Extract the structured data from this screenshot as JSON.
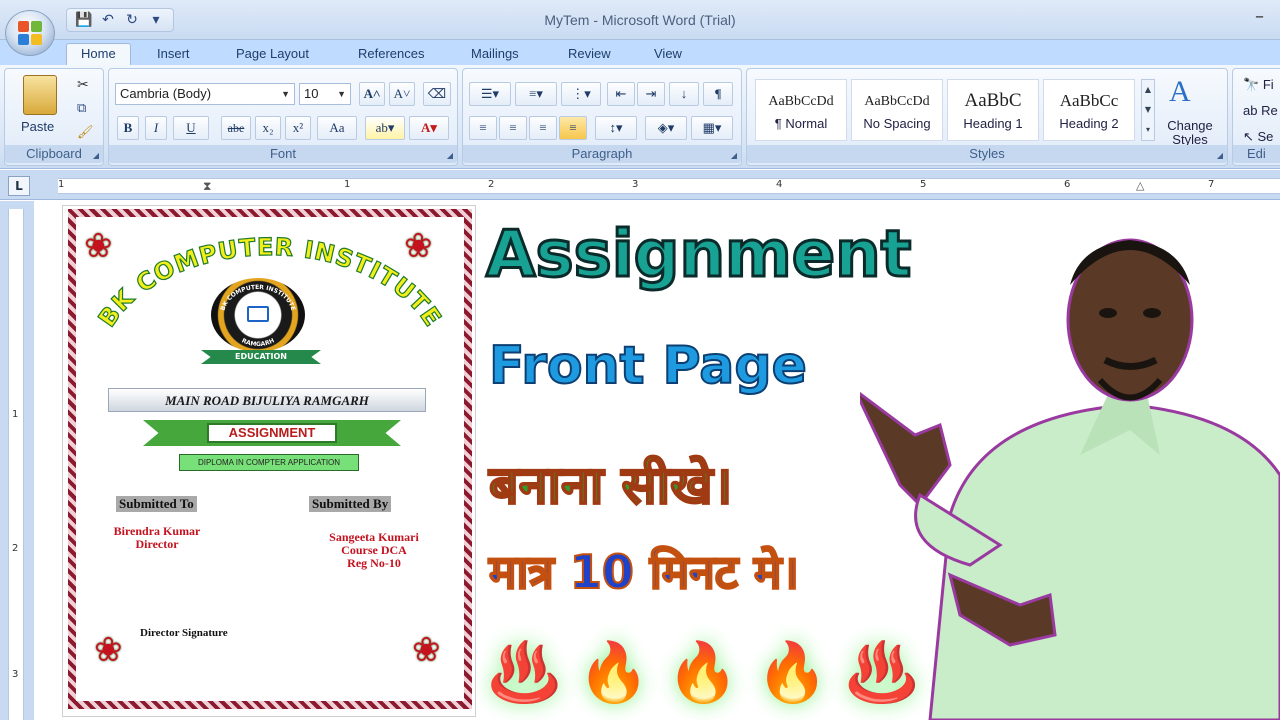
{
  "window": {
    "title": "MyTem - Microsoft Word (Trial)",
    "minimize": "–"
  },
  "qat": {
    "save": "💾",
    "undo": "↶",
    "redo": "↻",
    "more": "▾"
  },
  "tabs": [
    "Home",
    "Insert",
    "Page Layout",
    "References",
    "Mailings",
    "Review",
    "View"
  ],
  "ribbon": {
    "clipboard": {
      "label": "Clipboard",
      "paste": "Paste"
    },
    "font": {
      "label": "Font",
      "family": "Cambria (Body)",
      "size": "10",
      "bold": "B",
      "italic": "I",
      "underline": "U",
      "strike": "abe",
      "sub": "x₂",
      "sup": "x²",
      "case": "Aa"
    },
    "paragraph": {
      "label": "Paragraph"
    },
    "styles": {
      "label": "Styles",
      "tiles": [
        {
          "sample": "AaBbCcDd",
          "name": "¶ Normal"
        },
        {
          "sample": "AaBbCcDd",
          "name": "No Spacing"
        },
        {
          "sample": "AaBbC",
          "name": "Heading 1"
        },
        {
          "sample": "AaBbCc",
          "name": "Heading 2"
        }
      ],
      "change_styles": "Change Styles"
    },
    "editing": {
      "label": "Edi",
      "find": "Fi",
      "replace": "Re",
      "select": "Se"
    }
  },
  "ruler": {
    "corner": "L",
    "numbers": [
      "1",
      "1",
      "2",
      "3",
      "4",
      "5",
      "6",
      "7"
    ],
    "vnumbers": [
      "1",
      "2",
      "3"
    ]
  },
  "document": {
    "institute": "BK COMPUTER INSTITUTE",
    "logo_ring": "BK COMPUTER INSTITUTE",
    "logo_city": "RAMGARH",
    "logo_ribbon": "EDUCATION",
    "address": "MAIN ROAD BIJULIYA RAMGARH",
    "assignment": "ASSIGNMENT",
    "diploma": "DIPLOMA IN COMPTER APPLICATION",
    "submitted_to_header": "Submitted To",
    "submitted_by_header": "Submitted By",
    "submitted_to": [
      "Birendra Kumar",
      "Director"
    ],
    "submitted_by": [
      "Sangeeta Kumari",
      "Course DCA",
      "Reg No-10"
    ],
    "director_signature": "Director Signature"
  },
  "overlay": {
    "title": "Assignment",
    "subtitle": "Front Page",
    "hindi_line1": "बनाना सीखे।",
    "hindi_line2": "मात्र 10 मिनट मे।",
    "fire_icons": [
      "♨️",
      "🔥",
      "🔥",
      "🔥",
      "♨️"
    ]
  },
  "colors": {
    "accent_teal": "#17a294",
    "accent_blue": "#1e9be0",
    "hindi_green": "#2f9e2f",
    "hindi_blue": "#1e43c8"
  }
}
